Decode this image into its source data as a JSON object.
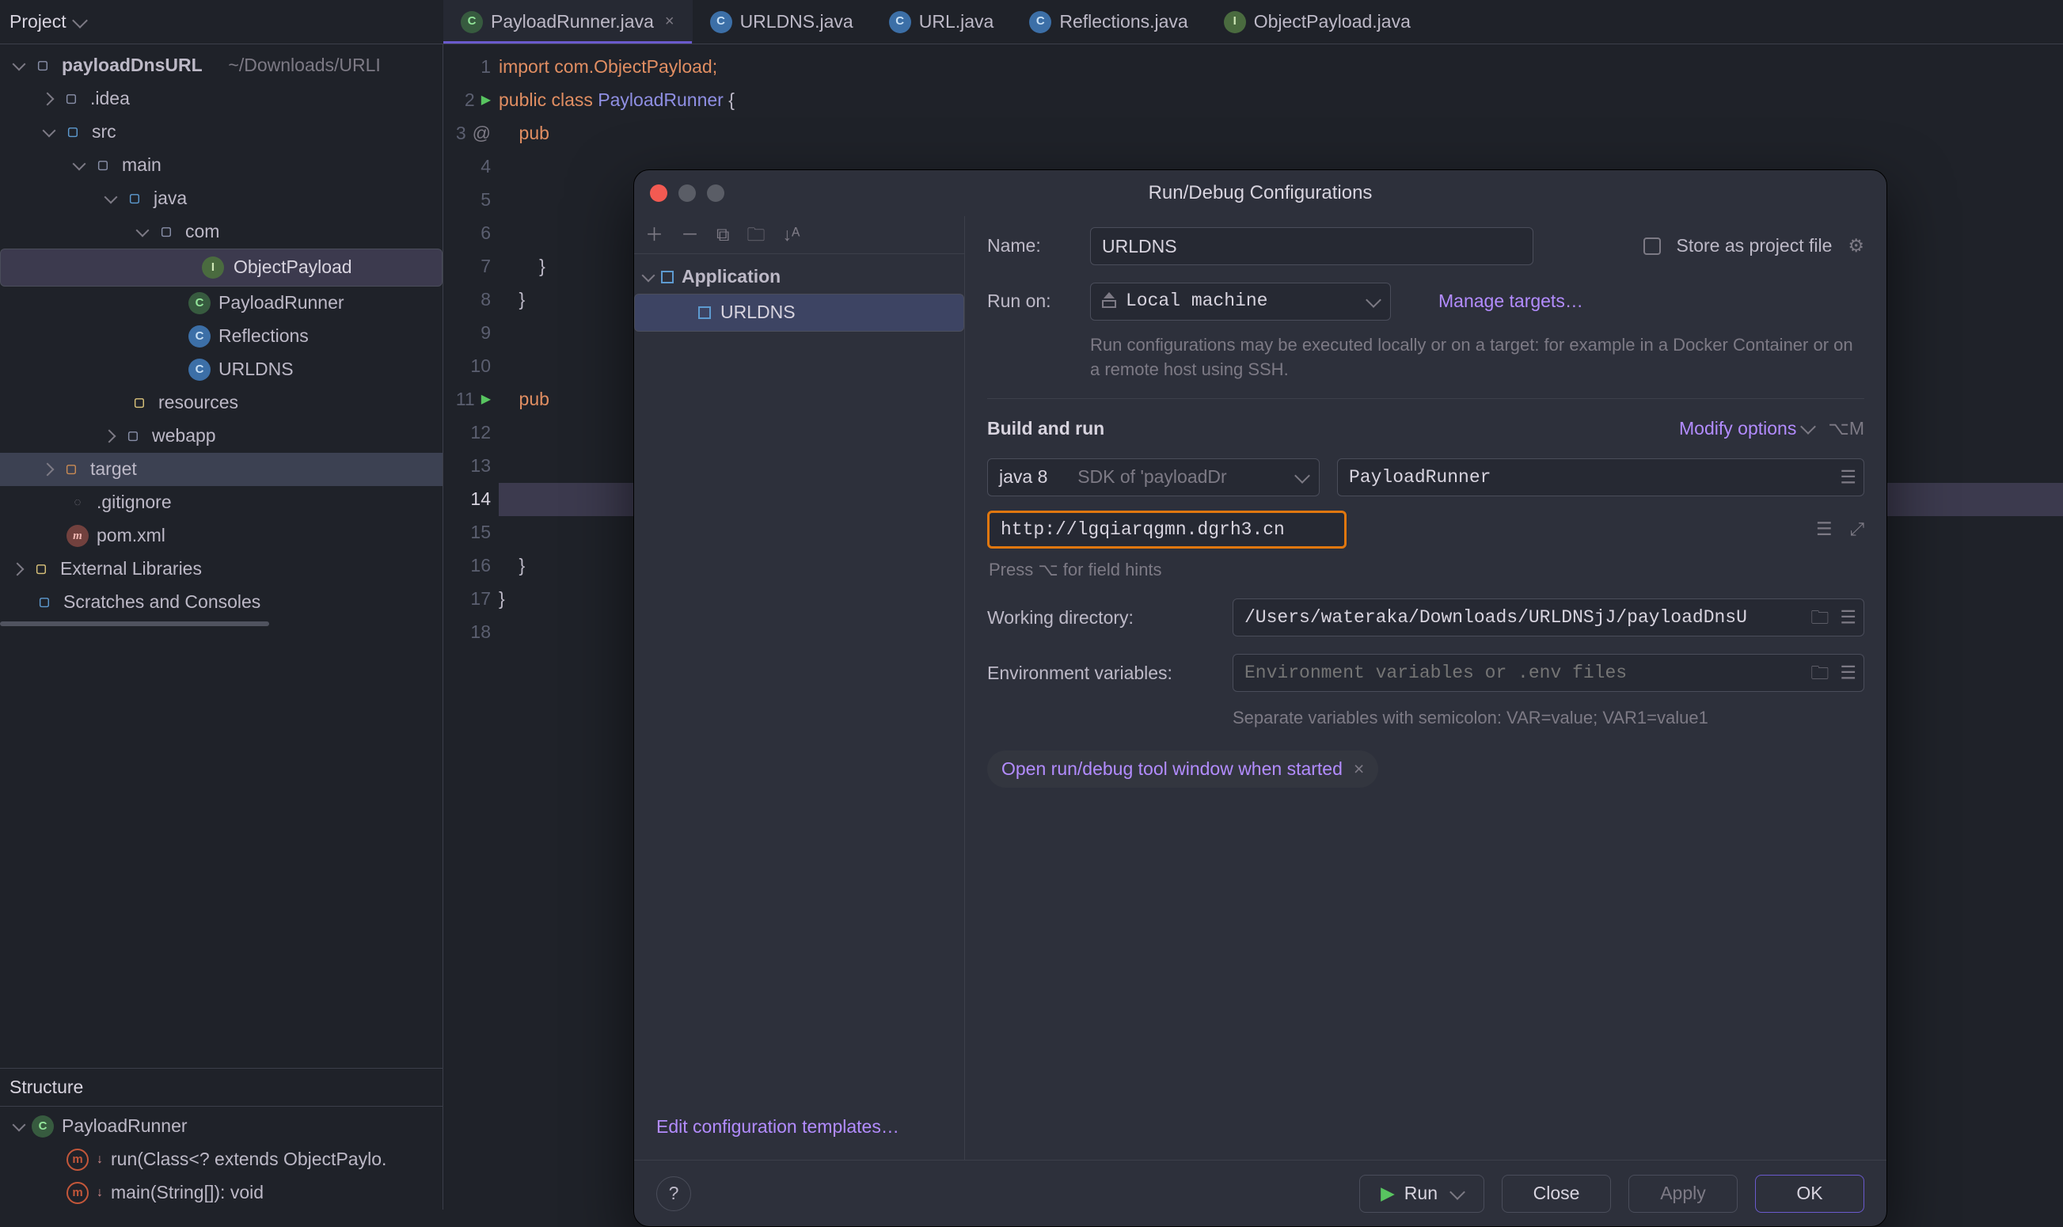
{
  "header": {
    "project_label": "Project"
  },
  "tabs": [
    {
      "name": "PayloadRunner.java",
      "icon": "runnable-class",
      "active": true,
      "closeable": true
    },
    {
      "name": "URLDNS.java",
      "icon": "class",
      "active": false
    },
    {
      "name": "URL.java",
      "icon": "class",
      "active": false
    },
    {
      "name": "Reflections.java",
      "icon": "class",
      "active": false
    },
    {
      "name": "ObjectPayload.java",
      "icon": "interface",
      "active": false
    }
  ],
  "project_tree": {
    "root": {
      "name": "payloadDnsURL",
      "path": "~/Downloads/URLI"
    },
    "idea": ".idea",
    "src": "src",
    "main": "main",
    "java": "java",
    "com": "com",
    "files": {
      "ObjectPayload": "ObjectPayload",
      "PayloadRunner": "PayloadRunner",
      "Reflections": "Reflections",
      "URLDNS": "URLDNS"
    },
    "resources": "resources",
    "webapp": "webapp",
    "target": "target",
    "gitignore": ".gitignore",
    "pom": "pom.xml",
    "ext_libs": "External Libraries",
    "scratches": "Scratches and Consoles"
  },
  "structure": {
    "title": "Structure",
    "class": "PayloadRunner",
    "methods": {
      "run": "run(Class<? extends ObjectPaylo.",
      "main": "main(String[]): void"
    }
  },
  "code": {
    "l1": "import com.ObjectPayload;",
    "l2_kw1": "public ",
    "l2_kw2": "class ",
    "l2_id": "PayloadRunner ",
    "l2_brace": "{",
    "l3": "    pub",
    "l7": "        }",
    "l11": "    pub",
    "l16": "    }",
    "l17": "}"
  },
  "modal": {
    "title": "Run/Debug Configurations",
    "side": {
      "application": "Application",
      "urldns": "URLDNS"
    },
    "name_label": "Name:",
    "name_value": "URLDNS",
    "store_label": "Store as project file",
    "run_on_label": "Run on:",
    "run_on_value": "Local machine",
    "manage_targets": "Manage targets…",
    "run_on_note": "Run configurations may be executed locally or on a target: for example in a Docker Container or on a remote host using SSH.",
    "build_run": "Build and run",
    "modify": "Modify options",
    "modify_shortcut": "⌥M",
    "sdk_label": "java 8",
    "sdk_hint": "SDK of 'payloadDr",
    "main_class": "PayloadRunner",
    "program_args": "http://lgqiarqgmn.dgrh3.cn",
    "args_hint": "Press ⌥ for field hints",
    "wd_label": "Working directory:",
    "wd_value": "/Users/wateraka/Downloads/URLDNSjJ/payloadDnsU",
    "env_label": "Environment variables:",
    "env_placeholder": "Environment variables or .env files",
    "env_hint": "Separate variables with semicolon: VAR=value; VAR1=value1",
    "chip": "Open run/debug tool window when started",
    "edit_templates": "Edit configuration templates…",
    "buttons": {
      "run": "Run",
      "close": "Close",
      "apply": "Apply",
      "ok": "OK"
    }
  }
}
